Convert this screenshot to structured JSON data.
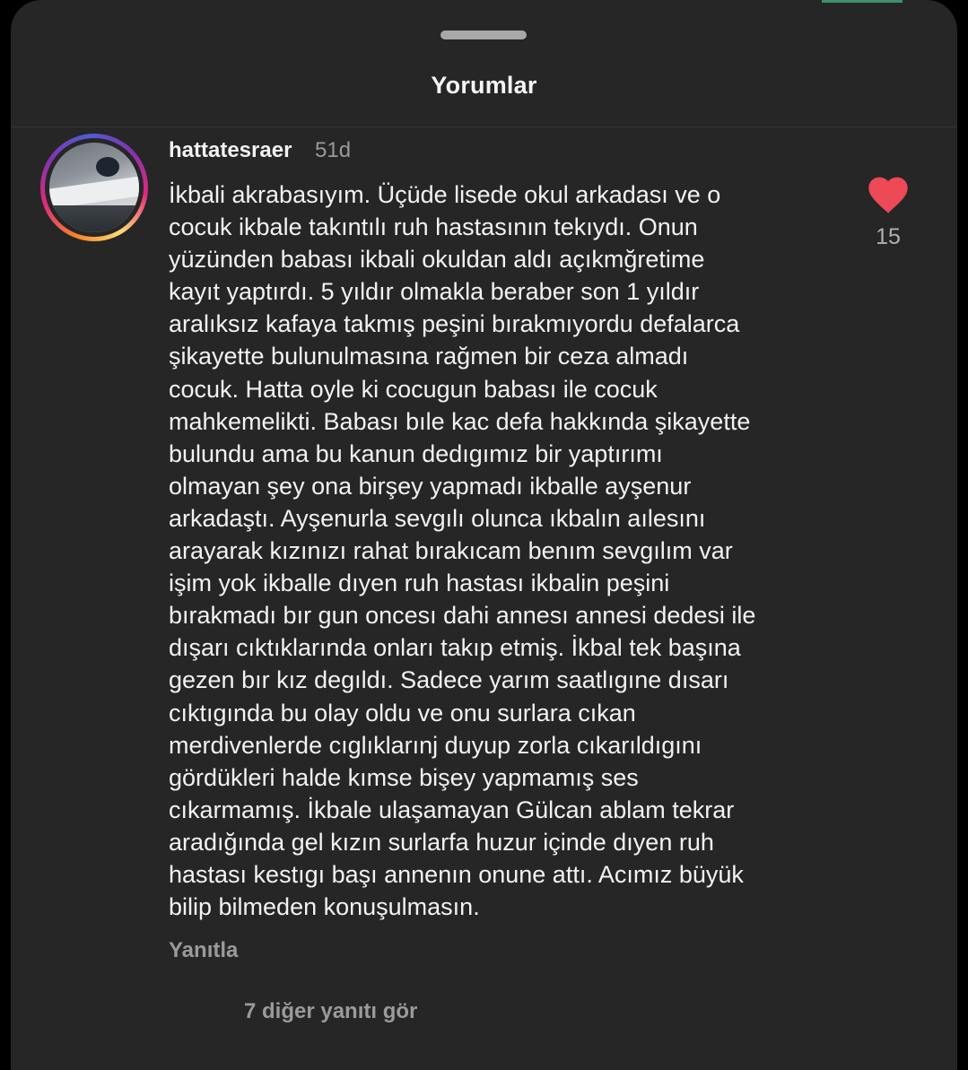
{
  "sheet": {
    "title": "Yorumlar"
  },
  "comment": {
    "username": "hattatesraer",
    "time": "51d",
    "text": "İkbali akrabasıyım. Üçüde lisede okul arkadası ve o\ncocuk ikbale takıntılı ruh hastasının tekıydı. Onun\nyüzünden babası ikbali okuldan aldı açıkmğretime\nkayıt yaptırdı. 5 yıldır  olmakla beraber son 1 yıldır\naralıksız kafaya takmış peşini bırakmıyordu  defalarca\nşikayette bulunulmasına rağmen bir ceza almadı\ncocuk. Hatta oyle ki cocugun babası ile cocuk\nmahkemelikti. Babası bıle kac defa hakkında şikayette\nbulundu ama bu kanun dedıgımız bir yaptırımı\nolmayan şey ona birşey yapmadı ikballe ayşenur\narkadaştı. Ayşenurla sevgılı olunca ıkbalın aılesını\narayarak kızınızı rahat bırakıcam benım sevgılım var\nişim yok ikballe dıyen ruh hastası ikbalin peşini\nbırakmadı bır gun oncesı dahi annesı annesi dedesi ile\ndışarı cıktıklarında onları takıp etmiş. İkbal tek başına\ngezen bır kız degıldı. Sadece yarım saatlıgıne dısarı\ncıktıgında bu olay oldu ve onu surlara cıkan\nmerdivenlerde cıglıklarınj duyup zorla cıkarıldıgını\ngördükleri halde  kımse bişey yapmamış ses\ncıkarmamış. İkbale ulaşamayan Gülcan ablam tekrar\naradığında gel kızın  surlarfa huzur içinde dıyen ruh\nhastası kestıgı başı annenın onune attı. Acımız büyük\nbilip bilmeden konuşulmasın.",
    "like_count": "15",
    "like_icon": "heart-filled",
    "like_color": "#ed4956",
    "reply_label": "Yanıtla",
    "view_replies_label": "7 diğer yanıtı gör"
  }
}
